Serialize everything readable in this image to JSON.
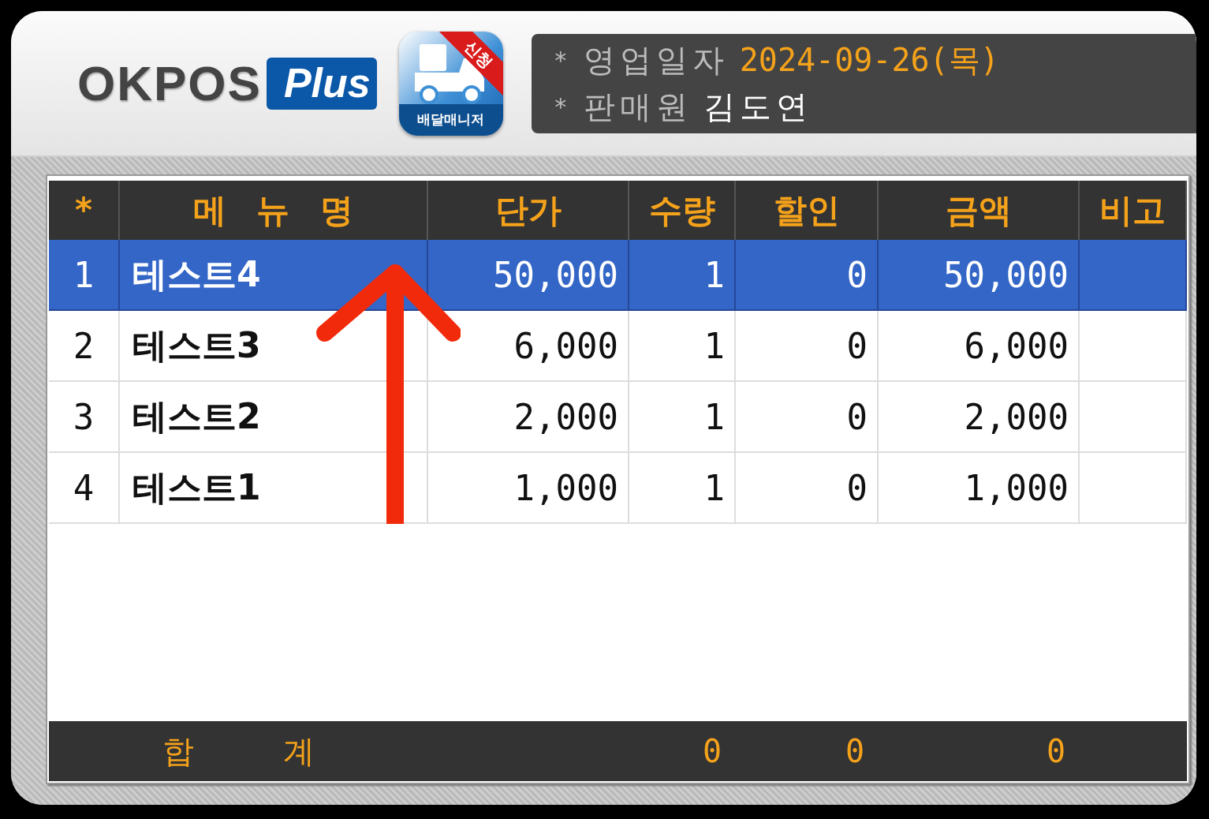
{
  "logo": {
    "name": "OKPOS",
    "suffix": "Plus"
  },
  "app_badge": {
    "label": "배달매니저",
    "ribbon": "신청"
  },
  "info": [
    {
      "marker": "*",
      "label": "영업일자",
      "value": "2024-09-26(목)",
      "kind": "date"
    },
    {
      "marker": "*",
      "label": "판매원",
      "value": "김도연",
      "kind": "person"
    }
  ],
  "table": {
    "columns": [
      "*",
      "메 뉴 명",
      "단가",
      "수량",
      "할인",
      "금액",
      "비고"
    ],
    "rows": [
      {
        "no": "1",
        "name": "테스트4",
        "price": "50,000",
        "qty": "1",
        "discount": "0",
        "amount": "50,000",
        "selected": true
      },
      {
        "no": "2",
        "name": "테스트3",
        "price": "6,000",
        "qty": "1",
        "discount": "0",
        "amount": "6,000",
        "selected": false
      },
      {
        "no": "3",
        "name": "테스트2",
        "price": "2,000",
        "qty": "1",
        "discount": "0",
        "amount": "2,000",
        "selected": false
      },
      {
        "no": "4",
        "name": "테스트1",
        "price": "1,000",
        "qty": "1",
        "discount": "0",
        "amount": "1,000",
        "selected": false
      }
    ]
  },
  "totals": {
    "label": "합 계",
    "qty": "0",
    "discount": "0",
    "amount": "0"
  }
}
